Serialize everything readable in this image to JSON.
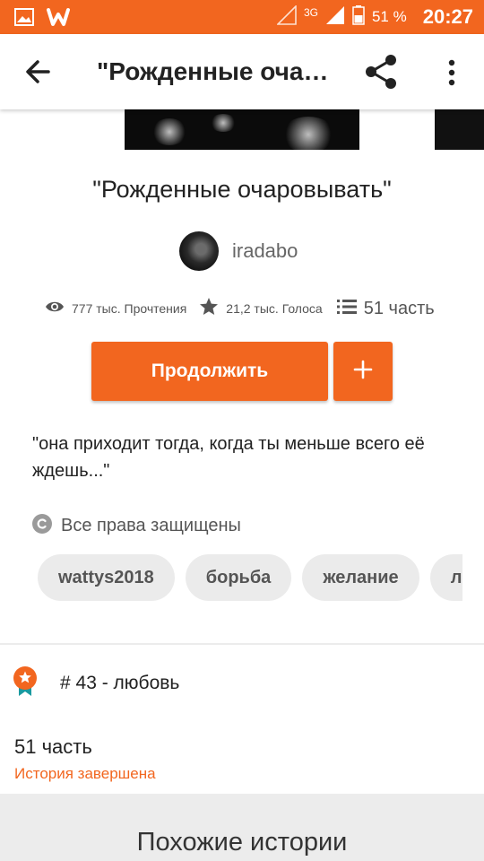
{
  "status_bar": {
    "network": "3G",
    "battery_pct": "51 %",
    "time": "20:27",
    "left_icons": [
      "gallery-icon",
      "wattpad-icon"
    ]
  },
  "app_bar": {
    "title": "\"Рожденные очаровывать\"",
    "icons": [
      "back-arrow-icon",
      "share-icon",
      "more-vertical-icon"
    ]
  },
  "story": {
    "title": "\"Рожденные очаровывать\"",
    "author": "iradabo",
    "stats": {
      "reads": "777 тыс. Прочтения",
      "votes": "21,2 тыс. Голоса",
      "parts": "51 часть"
    },
    "continue_label": "Продолжить",
    "add_label": "+",
    "description": "\"она приходит тогда, когда ты меньше всего её ждешь...\"",
    "copyright": "Все права защищены",
    "tags": [
      "wattys2018",
      "борьба",
      "желание",
      "лю"
    ],
    "rank": "# 43 - любовь",
    "parts_count": "51 часть",
    "status": "История завершена"
  },
  "similar": {
    "title": "Похожие истории"
  },
  "colors": {
    "accent": "#f2661f",
    "tag_bg": "#ebebeb",
    "badge_teal": "#1a9aa0"
  }
}
